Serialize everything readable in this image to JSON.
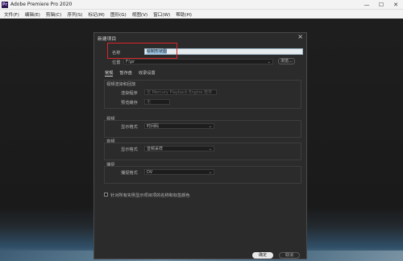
{
  "app": {
    "title": "Adobe Premiere Pro 2020",
    "logo": "Pr"
  },
  "window_controls": {
    "minimize": "—",
    "maximize": "☐",
    "close": "✕"
  },
  "menu": [
    "文件(F)",
    "编辑(E)",
    "剪辑(C)",
    "序列(S)",
    "标记(M)",
    "图形(G)",
    "视图(V)",
    "窗口(W)",
    "帮助(H)"
  ],
  "dialog": {
    "title": "新建项目",
    "close": "×",
    "name_label": "名称",
    "name_value": "绘制形状图",
    "location_label": "位置",
    "location_value": "F:\\pr",
    "browse_label": "浏览...",
    "tabs": [
      "常规",
      "暂存盘",
      "收录设置"
    ],
    "video_rendering": {
      "section": "视频渲染和回放",
      "renderer_label": "渲染程序",
      "renderer_value": "仅 Mercury Playback Engine 软件",
      "preview_label": "预览缓存",
      "preview_value": "无"
    },
    "video": {
      "section": "视频",
      "format_label": "显示格式",
      "format_value": "时间码"
    },
    "audio": {
      "section": "音频",
      "format_label": "显示格式",
      "format_value": "音频采样"
    },
    "capture": {
      "section": "捕捉",
      "format_label": "捕捉格式",
      "format_value": "DV"
    },
    "checkbox_label": "针对所有实例显示项目项的名称和标签颜色",
    "ok_label": "确定",
    "cancel_label": "取消"
  },
  "colors": {
    "highlight_box": "#d8252a",
    "dialog_bg": "#2b2b2b"
  }
}
